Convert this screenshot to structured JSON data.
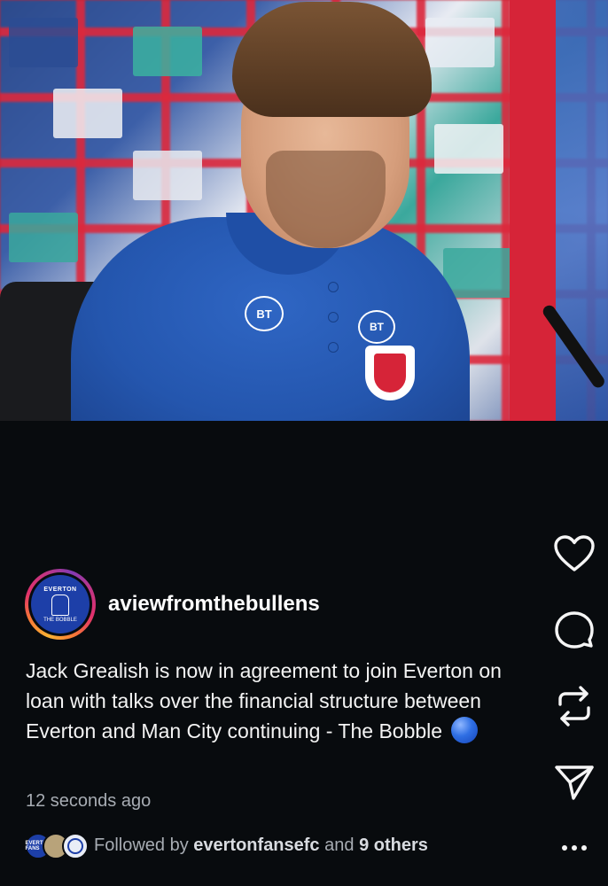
{
  "post": {
    "username": "aviewfromthebullens",
    "avatar_text_top": "EVERTON",
    "avatar_text_bottom": "THE BOBBLE",
    "caption": "Jack Grealish is now in agreement to join Everton on loan with talks over the financial structure between Everton and Man City continuing - The Bobble",
    "timestamp": "12 seconds ago",
    "followed_prefix": "Followed by",
    "followed_user": "evertonfansefc",
    "followed_and": "and",
    "followed_others": "9 others",
    "mini_avatar_labels": [
      "EVERTON FANS",
      "",
      ""
    ]
  },
  "photo": {
    "shirt_badge_1": "BT",
    "shirt_badge_2": "BT"
  },
  "actions": {
    "like_icon": "heart-icon",
    "comment_icon": "comment-icon",
    "repost_icon": "repost-icon",
    "share_icon": "send-icon",
    "more_icon": "more-icon"
  },
  "colors": {
    "background": "#080b0e",
    "caption_text": "#f4f4f4",
    "secondary_text": "#a7acb3",
    "avatar_blue": "#1d3fa8"
  }
}
